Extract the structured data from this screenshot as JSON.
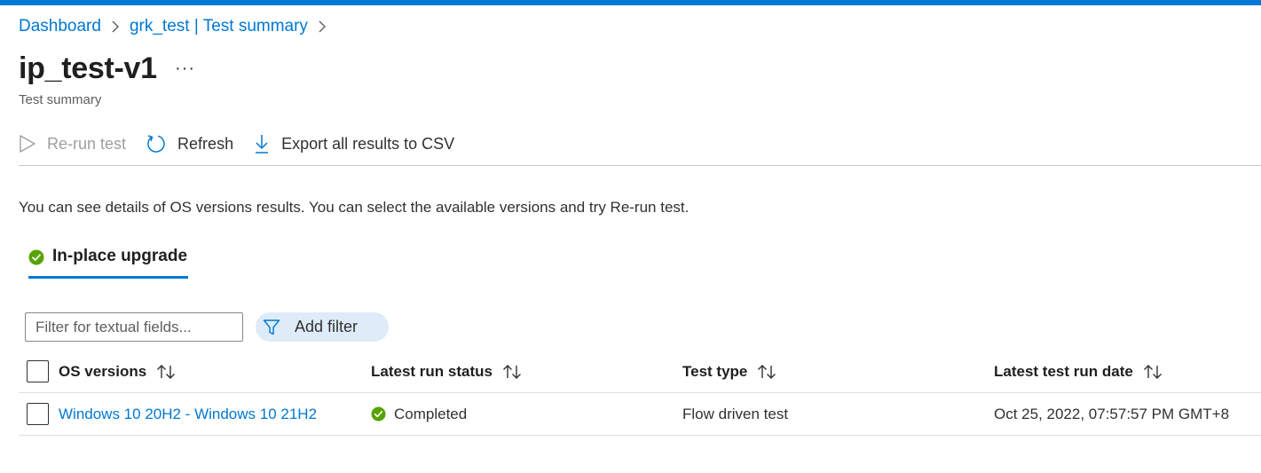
{
  "breadcrumb": {
    "items": [
      {
        "label": "Dashboard"
      },
      {
        "label": "grk_test | Test summary"
      }
    ]
  },
  "page": {
    "title": "ip_test-v1",
    "more_label": "···",
    "subtitle": "Test summary"
  },
  "toolbar": {
    "rerun_label": "Re-run test",
    "refresh_label": "Refresh",
    "export_label": "Export all results to CSV"
  },
  "description": "You can see details of OS versions results. You can select the available versions and try Re-run test.",
  "tab": {
    "label": "In-place upgrade",
    "icon": "success-check-icon"
  },
  "filter": {
    "placeholder": "Filter for textual fields...",
    "add_filter_label": "Add filter"
  },
  "table": {
    "columns": [
      {
        "label": "OS versions"
      },
      {
        "label": "Latest run status"
      },
      {
        "label": "Test type"
      },
      {
        "label": "Latest test run date"
      }
    ],
    "rows": [
      {
        "os_versions": "Windows 10 20H2 - Windows 10 21H2",
        "status": "Completed",
        "test_type": "Flow driven test",
        "date": "Oct 25, 2022, 07:57:57 PM GMT+8"
      }
    ]
  },
  "colors": {
    "accent": "#0078d4",
    "success": "#57a300",
    "filter_pill": "#deecf9"
  }
}
